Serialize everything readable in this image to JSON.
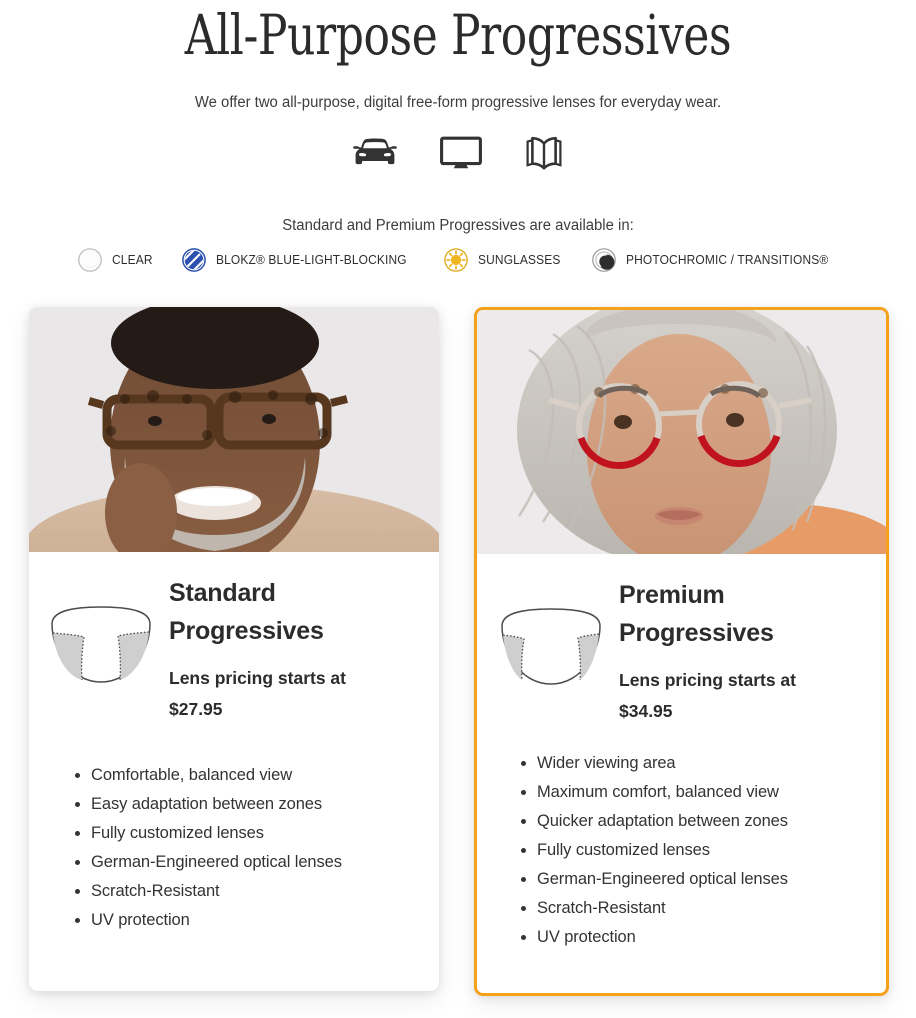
{
  "hero": {
    "title": "All-Purpose Progressives",
    "subtitle": "We offer two all-purpose, digital free-form progressive lenses for everyday wear."
  },
  "usage_icons": [
    {
      "name": "car-icon",
      "label": "Driving"
    },
    {
      "name": "monitor-icon",
      "label": "Computer"
    },
    {
      "name": "book-icon",
      "label": "Reading"
    }
  ],
  "availability": {
    "heading": "Standard and Premium Progressives are available in:",
    "options": [
      {
        "icon": "clear-lens-icon",
        "label": "CLEAR",
        "color": "#cfcfcf"
      },
      {
        "icon": "blokz-blue-light-icon",
        "label": "BLOKZ® BLUE-LIGHT-BLOCKING",
        "color": "#2b50b0"
      },
      {
        "icon": "sunglasses-icon",
        "label": "SUNGLASSES",
        "color": "#e8b227"
      },
      {
        "icon": "photochromic-icon",
        "label": "PHOTOCHROMIC / TRANSITIONS®",
        "color": "#3a3a3a"
      }
    ]
  },
  "cards": [
    {
      "id": "standard",
      "highlighted": false,
      "photo": {
        "name": "smiling-man-in-tortoise-glasses-photo",
        "alt": "Smiling man wearing tortoise-shell glasses"
      },
      "lens_diagram": {
        "name": "standard-lens-zones-diagram",
        "corridor": "narrow"
      },
      "title": "Standard Progressives",
      "price_label": "Lens pricing starts at",
      "price": "$27.95",
      "features": [
        "Comfortable, balanced view",
        "Easy adaptation between zones",
        "Fully customized lenses",
        "German-Engineered optical lenses",
        "Scratch-Resistant",
        "UV protection"
      ]
    },
    {
      "id": "premium",
      "highlighted": true,
      "highlight_color": "#F5A11B",
      "photo": {
        "name": "woman-in-red-glasses-photo",
        "alt": "Woman with grey hair wearing red-rimmed glasses"
      },
      "lens_diagram": {
        "name": "premium-lens-zones-diagram",
        "corridor": "wide"
      },
      "title": "Premium Progressives",
      "price_label": "Lens pricing starts at",
      "price": "$34.95",
      "features": [
        "Wider viewing area",
        "Maximum comfort, balanced view",
        "Quicker adaptation between zones",
        "Fully customized lenses",
        "German-Engineered optical lenses",
        "Scratch-Resistant",
        "UV protection"
      ]
    }
  ]
}
